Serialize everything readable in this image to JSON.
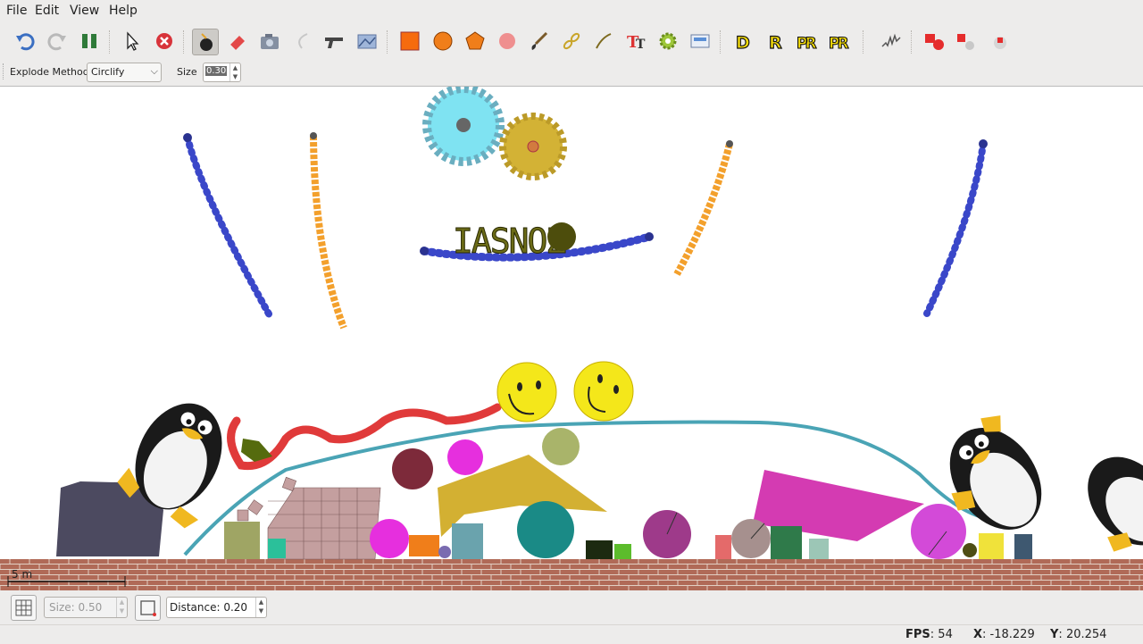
{
  "menu": {
    "file": "File",
    "edit": "Edit",
    "view": "View",
    "help": "Help"
  },
  "toolbar": {
    "icons": [
      "undo-icon",
      "redo-icon",
      "pause-icon",
      "select-arrow-icon",
      "delete-icon",
      "explode-bomb-icon",
      "eraser-icon",
      "camera-icon",
      "rope-icon",
      "gun-icon",
      "terrain-icon",
      "box-icon",
      "circle-icon",
      "polygon-icon",
      "ball-icon",
      "brush-icon",
      "chain-icon",
      "line-icon",
      "text-icon",
      "gear-icon",
      "image-icon",
      "d-icon",
      "r-icon",
      "pr-icon",
      "pr2-icon",
      "spring-icon",
      "flag-icon",
      "flag-off-icon",
      "small-flag-icon"
    ],
    "letters": {
      "d": "D",
      "r": "R",
      "pr": "PR",
      "pr2": "PR"
    }
  },
  "options": {
    "explode_label": "Explode Method",
    "explode_value": "Circlify",
    "size_label": "Size",
    "size_value": "0.30"
  },
  "canvas": {
    "scale_label": "5 m",
    "logo_text": "IASNOZ"
  },
  "bottom": {
    "size_value": "Size: 0.50",
    "distance_value": "Distance: 0.20"
  },
  "status": {
    "fps_label": "FPS",
    "fps_value": "54",
    "x_label": "X",
    "x_value": "-18.229",
    "y_label": "Y",
    "y_value": "20.254"
  },
  "colors": {
    "canvas_bg": "#ffffff",
    "ground": "#b36b59",
    "blue_chain": "#3a47c9",
    "orange_chain": "#f3a02c",
    "cyan_gear": "#7fe3f2",
    "gold_gear": "#d3b235",
    "smiley": "#f4e71a",
    "red_rope": "#e03a3a",
    "teal_rope": "#4aa4b5",
    "magenta": "#d43bb2"
  }
}
